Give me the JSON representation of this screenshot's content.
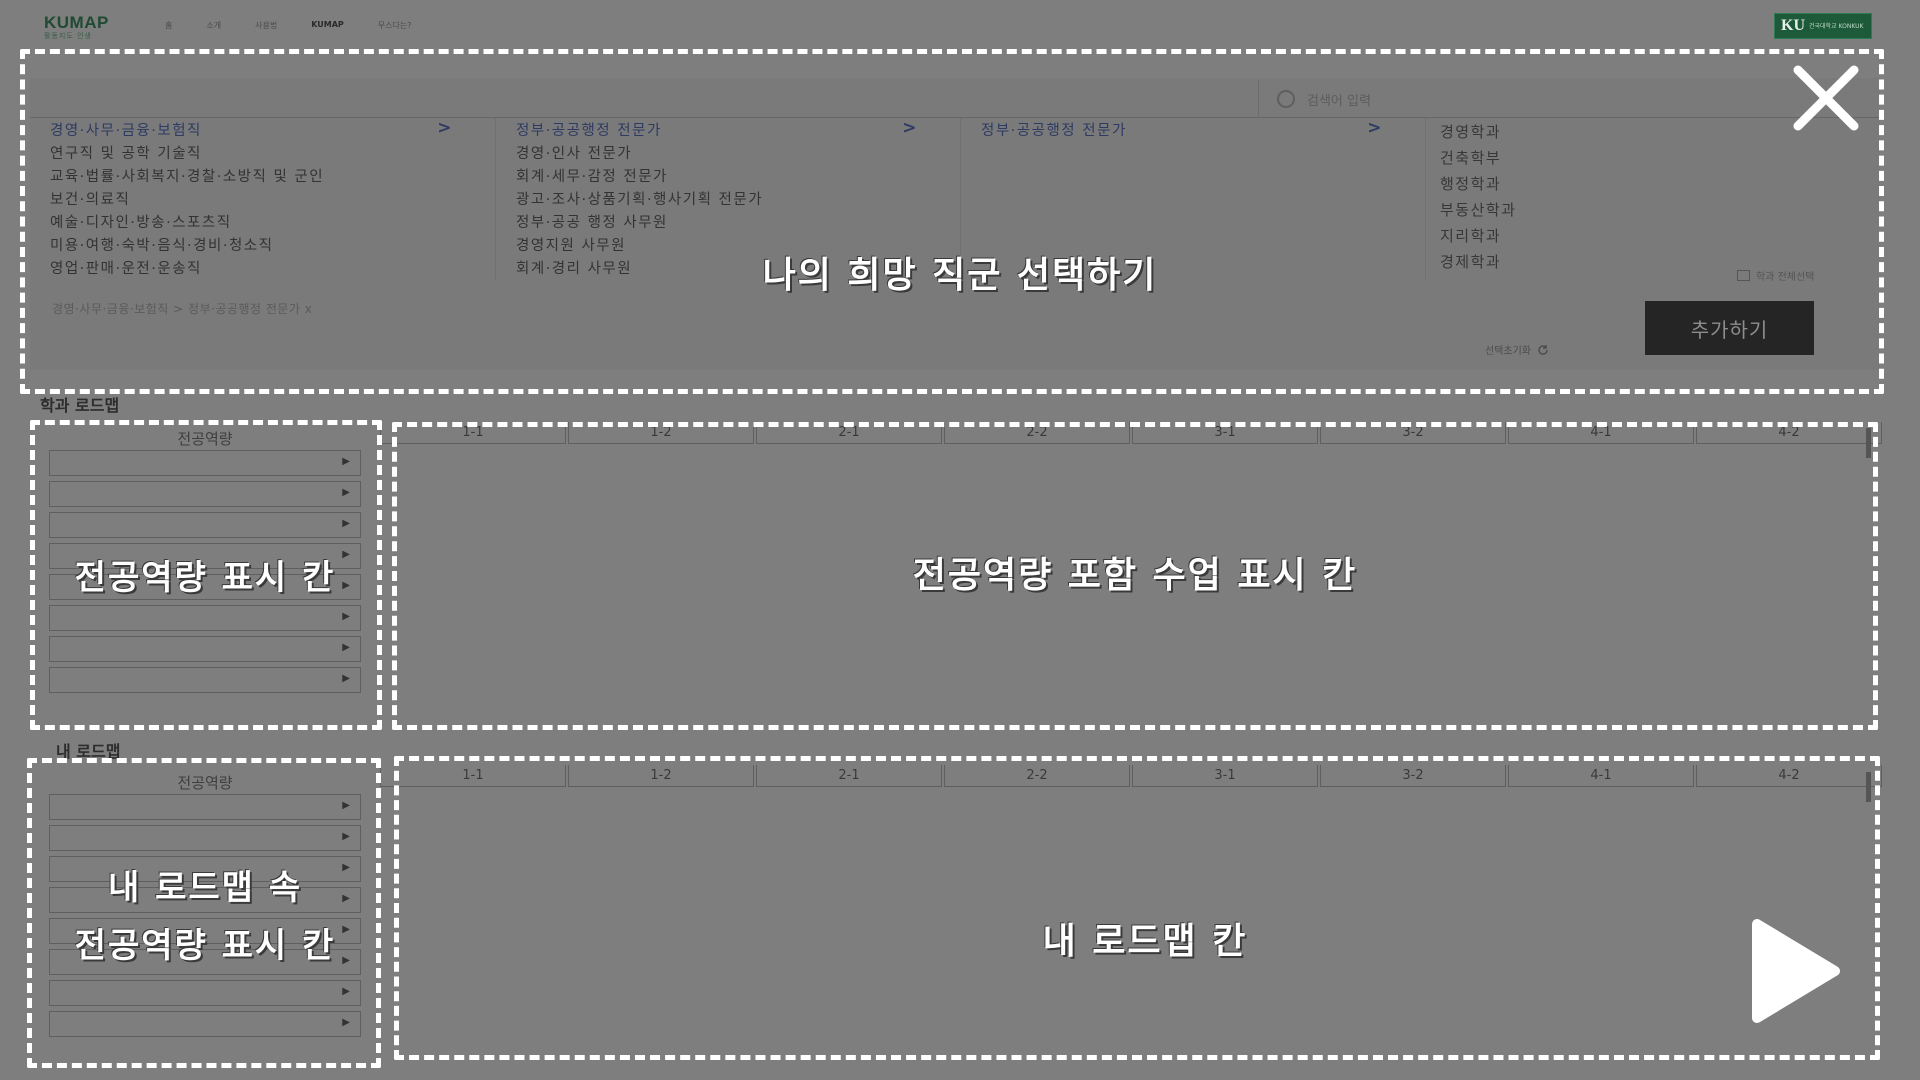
{
  "header": {
    "logo": "KUMAP",
    "logo_sub": "활동지도 인생",
    "nav": [
      "홈",
      "소개",
      "사용법",
      "KUMAP",
      "무스다는?"
    ],
    "badge_main": "KU",
    "badge_sub": "건국대학교 KONKUK"
  },
  "search": {
    "placeholder": "검색어 입력"
  },
  "columns": {
    "col1": [
      "경영·사무·금융·보험직",
      "연구직 및 공학 기술직",
      "교육·법률·사회복지·경찰·소방직 및 군인",
      "보건·의료직",
      "예술·디자인·방송·스포츠직",
      "미용·여행·숙박·음식·경비·청소직",
      "영업·판매·운전·운송직"
    ],
    "col2": [
      "정부·공공행정 전문가",
      "경영·인사 전문가",
      "회계·세무·감정 전문가",
      "광고·조사·상품기획·행사기획 전문가",
      "정부·공공 행정 사무원",
      "경영지원 사무원",
      "회계·경리 사무원"
    ],
    "col3": [
      "정부·공공행정 전문가"
    ],
    "col4": [
      "경영학과",
      "건축학부",
      "행정학과",
      "부동산학과",
      "지리학과",
      "경제학과"
    ],
    "chevron": ">"
  },
  "select_all": "학과 전체선택",
  "breadcrumb": "경영·사무·금융·보험직 > 정부·공공행정 전문가 x",
  "reset_label": "선택초기화",
  "add_button": "추가하기",
  "dept_roadmap": {
    "title": "학과 로드맵",
    "side_header": "전공역량",
    "semesters": [
      "1-1",
      "1-2",
      "2-1",
      "2-2",
      "3-1",
      "3-2",
      "4-1",
      "4-2"
    ]
  },
  "my_roadmap": {
    "title": "내 로드맵",
    "side_header": "전공역량",
    "semesters": [
      "1-1",
      "1-2",
      "2-1",
      "2-2",
      "3-1",
      "3-2",
      "4-1",
      "4-2"
    ]
  },
  "annotations": {
    "select_job": "나의 희망 직군 선택하기",
    "major_competency": "전공역량 표시 칸",
    "course_display": "전공역량 포함 수업 표시 칸",
    "my_competency_line1": "내 로드맵 속",
    "my_competency_line2": "전공역량 표시 칸",
    "my_roadmap": "내 로드맵 칸"
  },
  "icons": {
    "close": "close-icon",
    "play": "play-icon",
    "search": "search-icon",
    "reset": "refresh-icon"
  }
}
